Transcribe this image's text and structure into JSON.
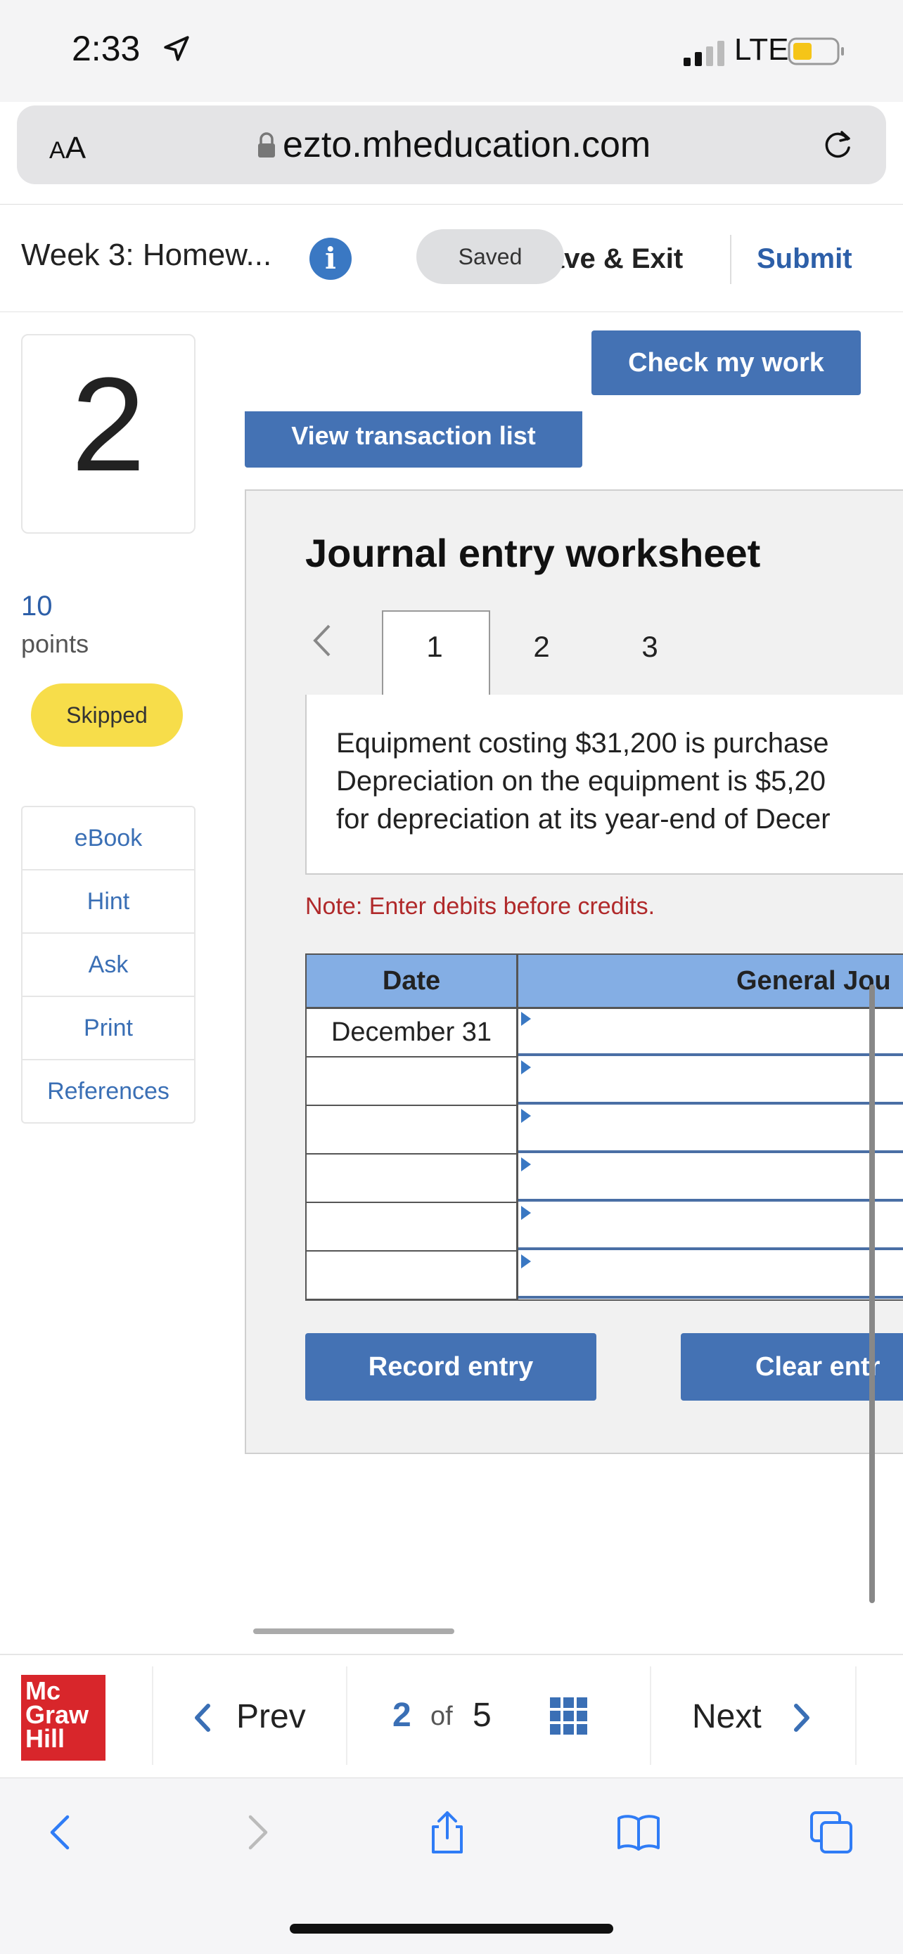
{
  "status_bar": {
    "time": "2:33",
    "network": "LTE"
  },
  "browser": {
    "text_size_label_small": "A",
    "text_size_label_large": "A",
    "url": "ezto.mheducation.com"
  },
  "header": {
    "title": "Week 3: Homew...",
    "info_label": "i",
    "saved_label": "Saved",
    "save_exit_label": "ave & Exit",
    "submit_label": "Submit"
  },
  "question": {
    "number": "2",
    "points_value": "10",
    "points_label": "points",
    "status": "Skipped"
  },
  "tools": [
    "eBook",
    "Hint",
    "Ask",
    "Print",
    "References"
  ],
  "actions": {
    "check_my_work": "Check my work",
    "view_transaction_list": "View transaction list"
  },
  "worksheet": {
    "title": "Journal entry worksheet",
    "tabs": [
      "1",
      "2",
      "3"
    ],
    "description_lines": [
      "Equipment costing $31,200 is purchase",
      "Depreciation on the equipment is $5,20",
      "for depreciation at its year-end of Decer"
    ],
    "note": "Note: Enter debits before credits.",
    "table": {
      "headers": {
        "date": "Date",
        "general_journal": "General Jou"
      },
      "rows": [
        {
          "date": "December 31"
        },
        {
          "date": ""
        },
        {
          "date": ""
        },
        {
          "date": ""
        },
        {
          "date": ""
        },
        {
          "date": ""
        }
      ]
    },
    "record_entry": "Record entry",
    "clear_entry": "Clear entr"
  },
  "bottom_nav": {
    "logo_lines": [
      "Mc",
      "Graw",
      "Hill"
    ],
    "prev_label": "Prev",
    "current_page": "2",
    "of_label": "of",
    "total_pages": "5",
    "next_label": "Next"
  },
  "colors": {
    "accent": "#4472b4",
    "header_blue": "#84aee4",
    "note_red": "#b0292a",
    "skipped_yellow": "#f7dd4a",
    "logo_red": "#d8262b"
  }
}
